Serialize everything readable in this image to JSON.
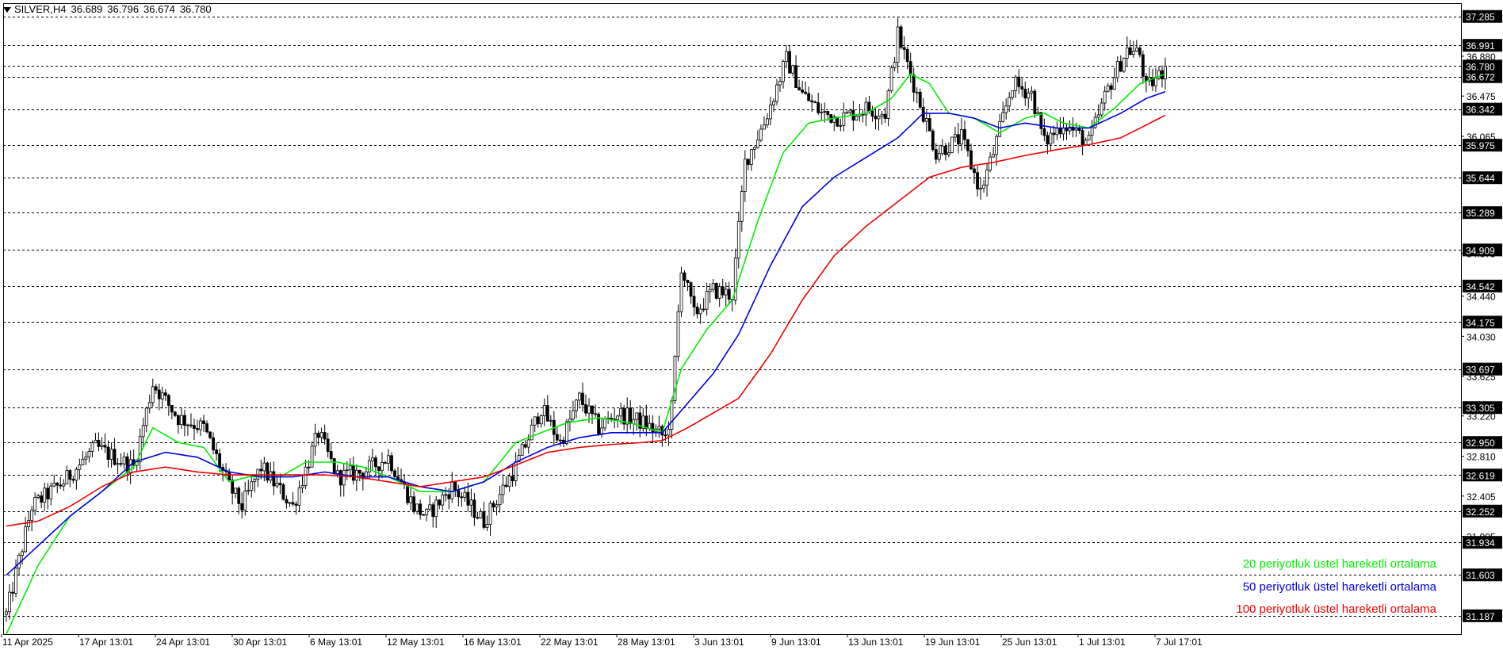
{
  "header": {
    "symbol": "SILVER,H4",
    "ohlc": [
      "36.689",
      "36.796",
      "36.674",
      "36.780"
    ]
  },
  "colors": {
    "ema20": "#00ee00",
    "ema50": "#0000dd",
    "ema100": "#ee0000",
    "candle": "#000000",
    "grid": "#000000",
    "price_tag_bg": "#000000",
    "price_tag_text": "#ffffff"
  },
  "legend": [
    {
      "label": "20 periyotluk üstel hareketli ortalama",
      "color": "#00ee00"
    },
    {
      "label": "50 periyotluk üstel hareketli ortalama",
      "color": "#0000dd"
    },
    {
      "label": "100 periyotluk üstel hareketli ortalama",
      "color": "#ee0000"
    }
  ],
  "chart_data": {
    "type": "line",
    "title": "SILVER,H4",
    "ylim": [
      31.0,
      37.42
    ],
    "x_tick_labels": [
      "11 Apr 2025",
      "17 Apr 13:01",
      "24 Apr 13:01",
      "30 Apr 13:01",
      "6 May 13:01",
      "12 May 13:01",
      "16 May 13:01",
      "22 May 13:01",
      "28 May 13:01",
      "3 Jun 13:01",
      "9 Jun 13:01",
      "13 Jun 13:01",
      "19 Jun 13:01",
      "25 Jun 13:01",
      "1 Jul 13:01",
      "7 Jul 17:01"
    ],
    "y_tick_labels": [
      "36.880",
      "36.475",
      "36.065",
      "34.875",
      "34.440",
      "34.030",
      "33.625",
      "33.220",
      "32.810",
      "32.405",
      "31.995"
    ],
    "level_lines": [
      "37.285",
      "36.991",
      "36.780",
      "36.672",
      "36.342",
      "35.975",
      "35.644",
      "35.289",
      "34.909",
      "34.542",
      "34.175",
      "33.697",
      "33.305",
      "32.950",
      "32.619",
      "32.252",
      "31.934",
      "31.603",
      "31.187"
    ],
    "current_price": "36.780",
    "candle_summary": {
      "description": "H4 price path approximated by anchor points (bar index, price)",
      "anchors": [
        [
          0,
          31.2
        ],
        [
          8,
          32.3
        ],
        [
          18,
          32.55
        ],
        [
          28,
          32.9
        ],
        [
          40,
          32.7
        ],
        [
          46,
          33.55
        ],
        [
          54,
          33.2
        ],
        [
          62,
          33.1
        ],
        [
          70,
          32.5
        ],
        [
          74,
          32.3
        ],
        [
          80,
          32.7
        ],
        [
          90,
          32.3
        ],
        [
          98,
          33.05
        ],
        [
          104,
          32.6
        ],
        [
          112,
          32.65
        ],
        [
          120,
          32.8
        ],
        [
          128,
          32.3
        ],
        [
          132,
          32.2
        ],
        [
          140,
          32.5
        ],
        [
          150,
          32.15
        ],
        [
          160,
          32.7
        ],
        [
          168,
          33.3
        ],
        [
          174,
          32.95
        ],
        [
          180,
          33.4
        ],
        [
          186,
          33.1
        ],
        [
          192,
          33.25
        ],
        [
          200,
          33.15
        ],
        [
          207,
          33.0
        ],
        [
          209,
          33.3
        ],
        [
          212,
          34.75
        ],
        [
          216,
          34.25
        ],
        [
          222,
          34.5
        ],
        [
          228,
          34.45
        ],
        [
          232,
          35.8
        ],
        [
          238,
          36.2
        ],
        [
          245,
          36.85
        ],
        [
          250,
          36.5
        ],
        [
          256,
          36.3
        ],
        [
          262,
          36.25
        ],
        [
          270,
          36.35
        ],
        [
          276,
          36.3
        ],
        [
          280,
          37.1
        ],
        [
          286,
          36.5
        ],
        [
          292,
          35.9
        ],
        [
          300,
          36.05
        ],
        [
          306,
          35.5
        ],
        [
          310,
          35.9
        ],
        [
          316,
          36.6
        ],
        [
          322,
          36.5
        ],
        [
          326,
          36.0
        ],
        [
          332,
          36.2
        ],
        [
          340,
          36.0
        ],
        [
          346,
          36.55
        ],
        [
          352,
          36.95
        ],
        [
          356,
          36.9
        ],
        [
          358,
          36.55
        ],
        [
          364,
          36.75
        ]
      ]
    },
    "series": [
      {
        "name": "20 periyotluk üstel hareketli ortalama",
        "values": [
          [
            0,
            31.0
          ],
          [
            10,
            31.7
          ],
          [
            20,
            32.2
          ],
          [
            30,
            32.45
          ],
          [
            40,
            32.7
          ],
          [
            46,
            33.1
          ],
          [
            54,
            32.95
          ],
          [
            62,
            32.9
          ],
          [
            70,
            32.55
          ],
          [
            76,
            32.6
          ],
          [
            86,
            32.6
          ],
          [
            94,
            32.75
          ],
          [
            104,
            32.75
          ],
          [
            112,
            32.7
          ],
          [
            120,
            32.6
          ],
          [
            130,
            32.45
          ],
          [
            140,
            32.45
          ],
          [
            150,
            32.55
          ],
          [
            160,
            32.95
          ],
          [
            168,
            33.05
          ],
          [
            176,
            33.15
          ],
          [
            186,
            33.2
          ],
          [
            196,
            33.15
          ],
          [
            206,
            33.05
          ],
          [
            212,
            33.7
          ],
          [
            220,
            34.1
          ],
          [
            228,
            34.4
          ],
          [
            236,
            35.2
          ],
          [
            244,
            35.9
          ],
          [
            252,
            36.2
          ],
          [
            260,
            36.25
          ],
          [
            270,
            36.3
          ],
          [
            278,
            36.45
          ],
          [
            284,
            36.7
          ],
          [
            290,
            36.6
          ],
          [
            296,
            36.3
          ],
          [
            304,
            36.25
          ],
          [
            312,
            36.1
          ],
          [
            320,
            36.25
          ],
          [
            326,
            36.3
          ],
          [
            332,
            36.2
          ],
          [
            340,
            36.15
          ],
          [
            348,
            36.35
          ],
          [
            356,
            36.6
          ],
          [
            364,
            36.7
          ]
        ]
      },
      {
        "name": "50 periyotluk üstel hareketli ortalama",
        "values": [
          [
            0,
            31.6
          ],
          [
            10,
            31.9
          ],
          [
            20,
            32.2
          ],
          [
            30,
            32.45
          ],
          [
            40,
            32.75
          ],
          [
            50,
            32.85
          ],
          [
            60,
            32.8
          ],
          [
            70,
            32.65
          ],
          [
            80,
            32.6
          ],
          [
            90,
            32.6
          ],
          [
            100,
            32.65
          ],
          [
            110,
            32.6
          ],
          [
            120,
            32.6
          ],
          [
            130,
            32.5
          ],
          [
            140,
            32.45
          ],
          [
            150,
            32.55
          ],
          [
            160,
            32.75
          ],
          [
            170,
            32.9
          ],
          [
            180,
            33.0
          ],
          [
            190,
            33.05
          ],
          [
            200,
            33.05
          ],
          [
            206,
            33.05
          ],
          [
            214,
            33.35
          ],
          [
            222,
            33.65
          ],
          [
            230,
            34.05
          ],
          [
            240,
            34.75
          ],
          [
            250,
            35.35
          ],
          [
            260,
            35.65
          ],
          [
            270,
            35.85
          ],
          [
            280,
            36.05
          ],
          [
            288,
            36.3
          ],
          [
            296,
            36.3
          ],
          [
            304,
            36.25
          ],
          [
            312,
            36.15
          ],
          [
            320,
            36.2
          ],
          [
            330,
            36.15
          ],
          [
            340,
            36.15
          ],
          [
            350,
            36.3
          ],
          [
            358,
            36.45
          ],
          [
            364,
            36.52
          ]
        ]
      },
      {
        "name": "100 periyotluk üstel hareketli ortalama",
        "values": [
          [
            0,
            32.1
          ],
          [
            10,
            32.15
          ],
          [
            20,
            32.3
          ],
          [
            30,
            32.5
          ],
          [
            40,
            32.65
          ],
          [
            50,
            32.7
          ],
          [
            60,
            32.65
          ],
          [
            70,
            32.62
          ],
          [
            80,
            32.62
          ],
          [
            90,
            32.62
          ],
          [
            100,
            32.62
          ],
          [
            110,
            32.6
          ],
          [
            120,
            32.55
          ],
          [
            130,
            32.5
          ],
          [
            140,
            32.55
          ],
          [
            150,
            32.6
          ],
          [
            160,
            32.72
          ],
          [
            170,
            32.85
          ],
          [
            180,
            32.9
          ],
          [
            190,
            32.93
          ],
          [
            200,
            32.95
          ],
          [
            206,
            32.97
          ],
          [
            214,
            33.1
          ],
          [
            222,
            33.25
          ],
          [
            230,
            33.4
          ],
          [
            240,
            33.85
          ],
          [
            250,
            34.4
          ],
          [
            260,
            34.85
          ],
          [
            270,
            35.15
          ],
          [
            280,
            35.4
          ],
          [
            290,
            35.65
          ],
          [
            300,
            35.75
          ],
          [
            310,
            35.8
          ],
          [
            320,
            35.87
          ],
          [
            330,
            35.93
          ],
          [
            340,
            35.98
          ],
          [
            350,
            36.05
          ],
          [
            358,
            36.18
          ],
          [
            364,
            36.28
          ]
        ]
      }
    ]
  }
}
